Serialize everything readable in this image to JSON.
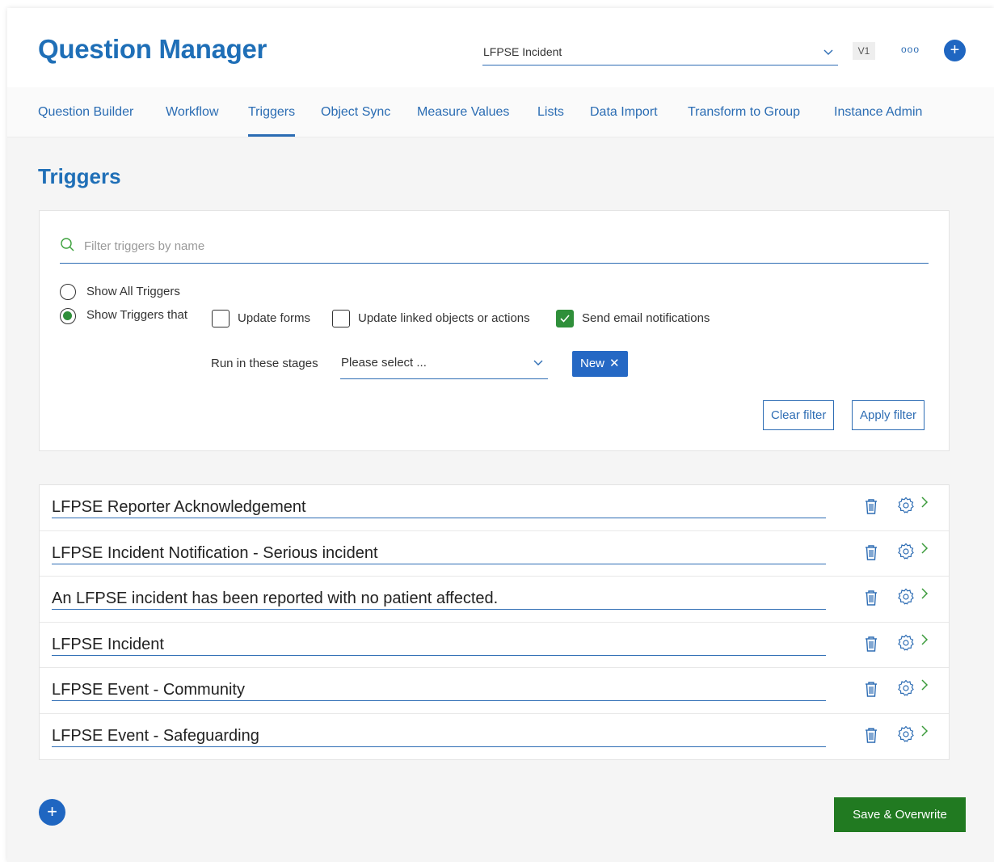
{
  "header": {
    "app_title": "Question Manager",
    "form_select": "LFPSE Incident",
    "version": "V1",
    "more_label": "ooo",
    "add_label": "+"
  },
  "nav": [
    {
      "label": "Question Builder"
    },
    {
      "label": "Workflow"
    },
    {
      "label": "Triggers",
      "active": true
    },
    {
      "label": "Object Sync"
    },
    {
      "label": "Measure Values"
    },
    {
      "label": "Lists"
    },
    {
      "label": "Data Import"
    },
    {
      "label": "Transform to Group"
    },
    {
      "label": "Instance Admin"
    }
  ],
  "page_title": "Triggers",
  "filter": {
    "search_placeholder": "Filter triggers by name",
    "search_value": "",
    "radio_all": "Show All Triggers",
    "radio_that": "Show Triggers that",
    "selected_radio": "that",
    "cb_update_forms": "Update forms",
    "cb_update_forms_checked": false,
    "cb_update_linked": "Update linked objects or actions",
    "cb_update_linked_checked": false,
    "cb_send_email": "Send email notifications",
    "cb_send_email_checked": true,
    "stages_label": "Run in these stages",
    "stages_placeholder": "Please select ...",
    "stage_tag": "New",
    "tag_remove": "✕",
    "clear_label": "Clear filter",
    "apply_label": "Apply filter"
  },
  "triggers": [
    "LFPSE Reporter Acknowledgement",
    "LFPSE Incident Notification - Serious incident",
    "An LFPSE incident has been reported with no patient affected.",
    "LFPSE Incident",
    "LFPSE Event - Community",
    "LFPSE Event - Safeguarding"
  ],
  "footer": {
    "add_label": "+",
    "save_label": "Save & Overwrite"
  },
  "colors": {
    "primary": "#1f6fb7",
    "success": "#217a21",
    "check": "#2f8f3a",
    "tag": "#2568c4"
  },
  "icons": {
    "search": "search-icon",
    "trash": "trash-icon",
    "gear": "gear-icon",
    "chevron": "chevron-right-icon"
  }
}
